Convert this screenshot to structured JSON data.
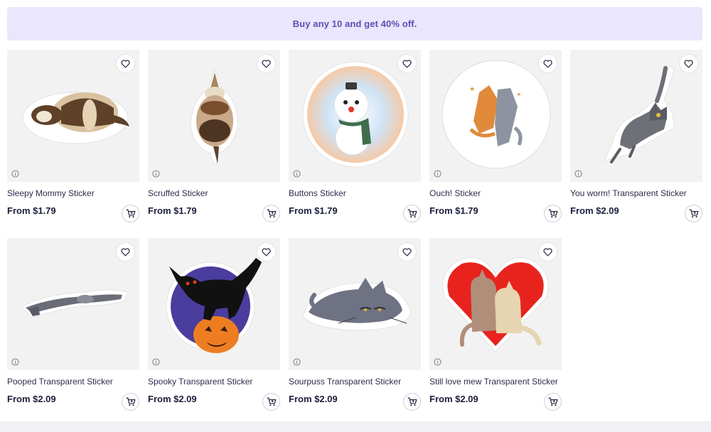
{
  "promo": {
    "text": "Buy any 10 and get 40% off."
  },
  "products": [
    {
      "title": "Sleepy Mommy Sticker",
      "price": "From $1.79",
      "icon": "sleeping-ferret-sticker"
    },
    {
      "title": "Scruffed Sticker",
      "price": "From $1.79",
      "icon": "scruffed-ferret-sticker"
    },
    {
      "title": "Buttons Sticker",
      "price": "From $1.79",
      "icon": "snowman-cat-sticker"
    },
    {
      "title": "Ouch! Sticker",
      "price": "From $1.79",
      "icon": "fighting-cats-sticker"
    },
    {
      "title": "You worm! Transparent Sticker",
      "price": "From $2.09",
      "icon": "grey-cat-sticker"
    },
    {
      "title": "Pooped Transparent Sticker",
      "price": "From $2.09",
      "icon": "flat-ferret-sticker"
    },
    {
      "title": "Spooky Transparent Sticker",
      "price": "From $2.09",
      "icon": "black-cat-pumpkin-sticker"
    },
    {
      "title": "Sourpuss Transparent Sticker",
      "price": "From $2.09",
      "icon": "grumpy-cat-sticker"
    },
    {
      "title": "Still love mew Transparent Sticker",
      "price": "From $2.09",
      "icon": "hugging-cats-heart-sticker"
    }
  ],
  "colors": {
    "promo_bg": "#e9e6fd",
    "promo_text": "#5b4fb1",
    "price_text": "#1b1d3c"
  }
}
